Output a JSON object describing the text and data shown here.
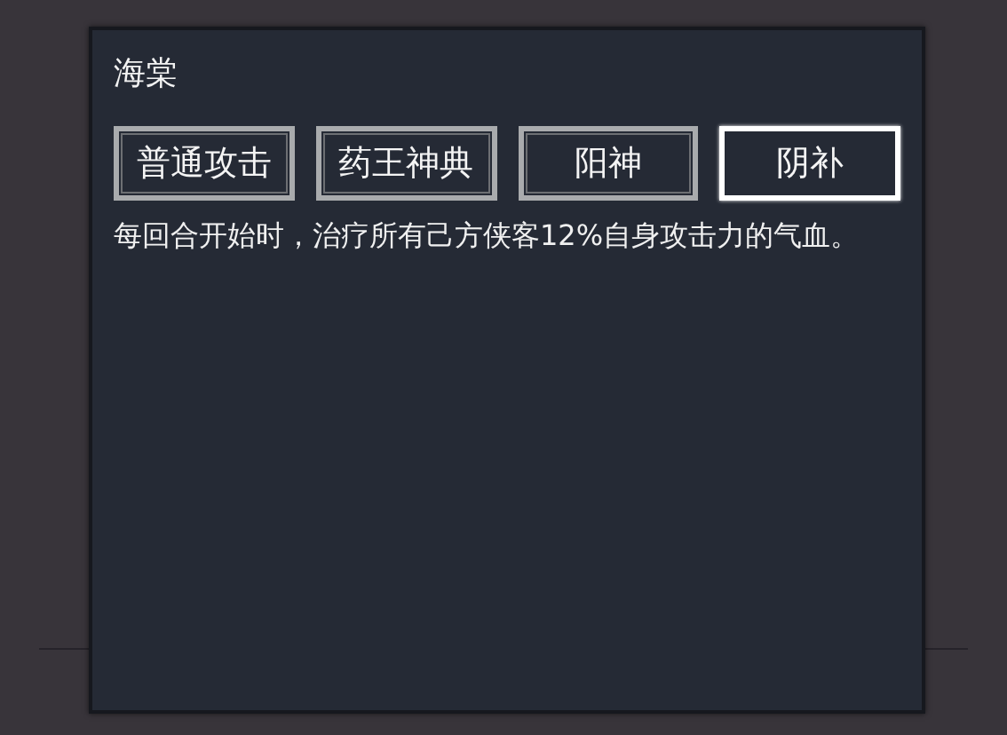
{
  "dialog": {
    "title": "海棠",
    "skills": [
      {
        "label": "普通攻击",
        "selected": false
      },
      {
        "label": "药王神典",
        "selected": false
      },
      {
        "label": "阳神",
        "selected": false
      },
      {
        "label": "阴补",
        "selected": true
      }
    ],
    "description": "每回合开始时，治疗所有己方侠客12%自身攻击力的气血。"
  }
}
